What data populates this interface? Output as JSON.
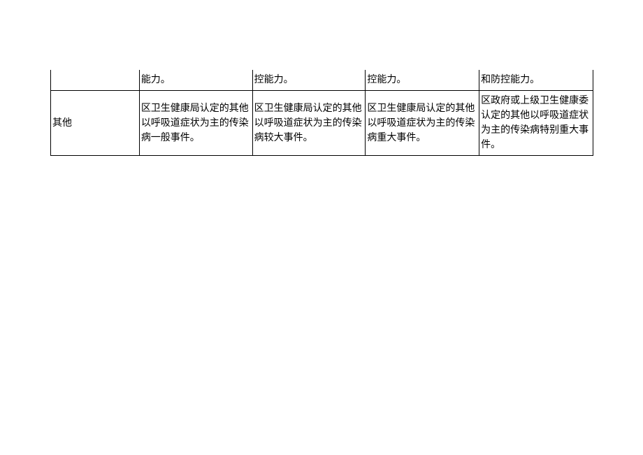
{
  "table": {
    "row1": {
      "c1": "",
      "c2": "能力。",
      "c3": "控能力。",
      "c4": "控能力。",
      "c5": "和防控能力。"
    },
    "row2": {
      "c1": "其他",
      "c2": "区卫生健康局认定的其他以呼吸道症状为主的传染病一般事件。",
      "c3": "区卫生健康局认定的其他以呼吸道症状为主的传染病较大事件。",
      "c4": "区卫生健康局认定的其他以呼吸道症状为主的传染病重大事件。",
      "c5": "区政府或上级卫生健康委认定的其他以呼吸道症状为主的传染病特别重大事件。"
    }
  }
}
